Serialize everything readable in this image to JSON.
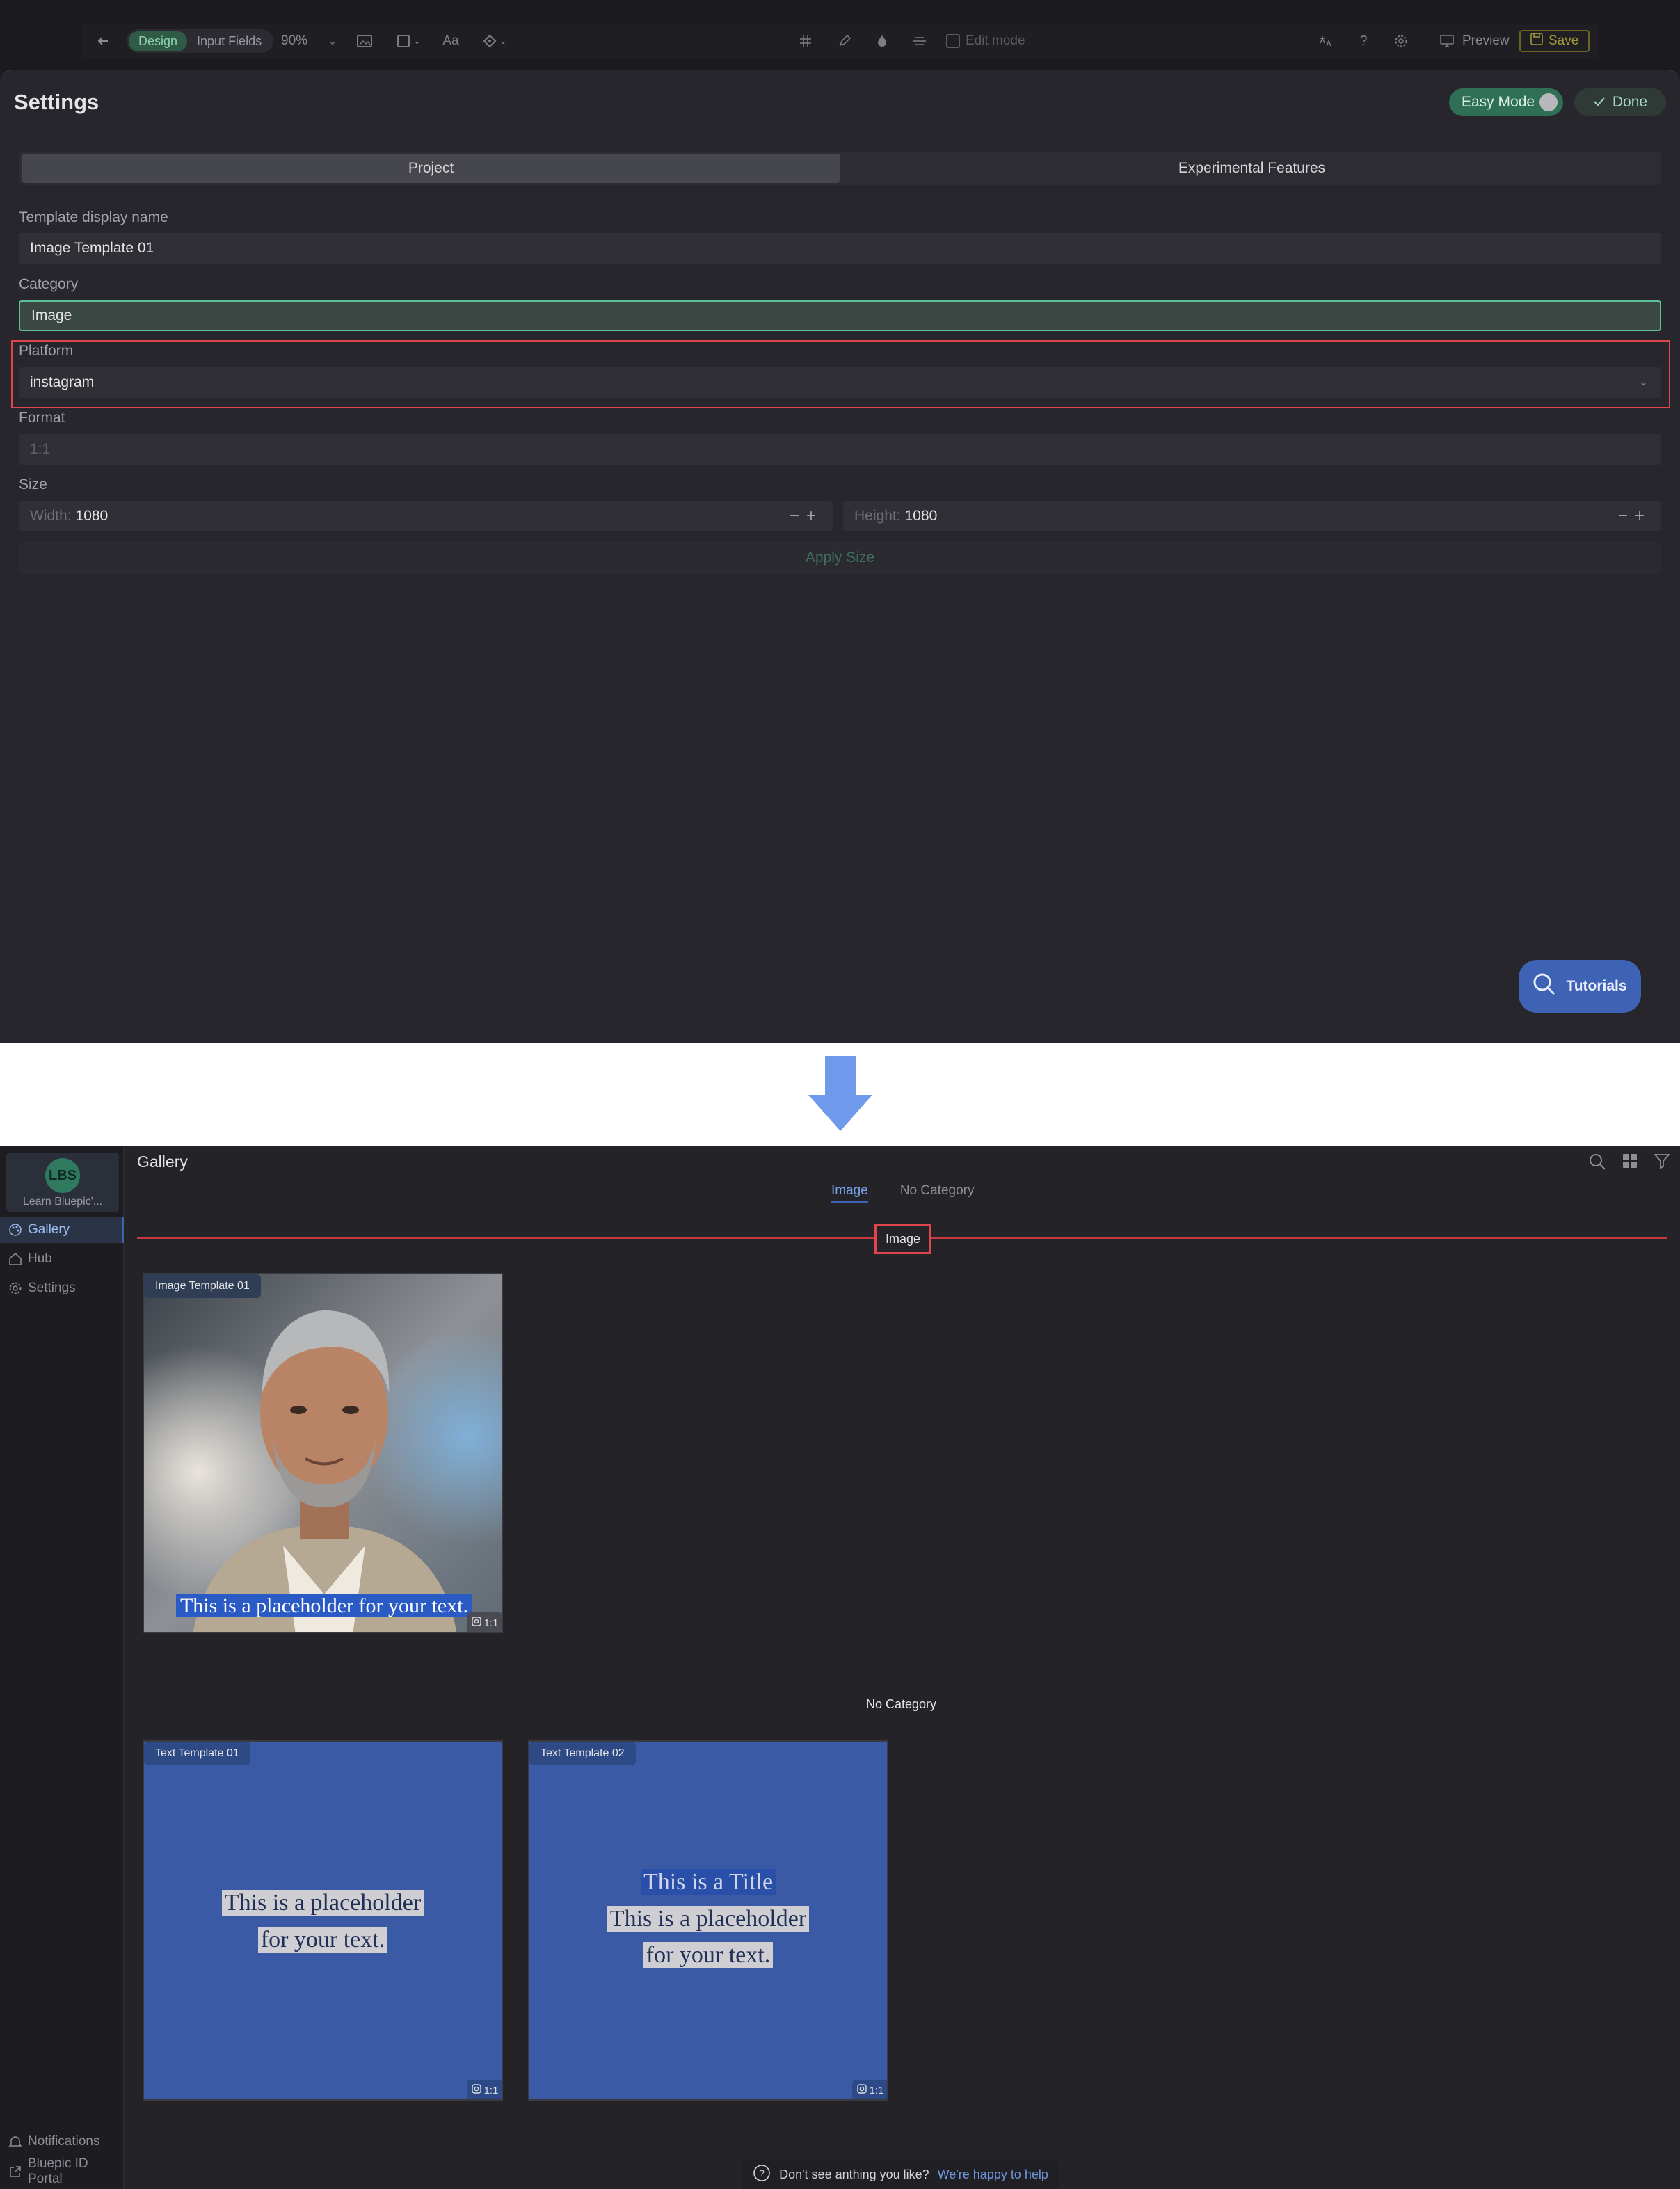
{
  "toolbar": {
    "mode_design": "Design",
    "mode_inputs": "Input Fields",
    "zoom": "90%",
    "edit_mode": "Edit mode",
    "preview": "Preview",
    "save": "Save"
  },
  "settings": {
    "title": "Settings",
    "easy_mode": "Easy Mode",
    "done": "Done",
    "tabs": [
      "Project",
      "Experimental Features"
    ],
    "template_label": "Template display name",
    "template_value": "Image Template 01",
    "category_label": "Category",
    "category_value": "Image",
    "platform_label": "Platform",
    "platform_value": "instagram",
    "format_label": "Format",
    "format_value": "1:1",
    "size_label": "Size",
    "width_prefix": "Width:",
    "width_value": "1080",
    "height_prefix": "Height:",
    "height_value": "1080",
    "apply_size": "Apply Size",
    "tutorials": "Tutorials"
  },
  "gallery": {
    "account_initials": "LBS",
    "account_name": "Learn Bluepic'...",
    "nav": [
      "Gallery",
      "Hub",
      "Settings"
    ],
    "bottom_nav": [
      "Notifications",
      "Bluepic ID Portal"
    ],
    "title": "Gallery",
    "subtabs": [
      "Image",
      "No Category"
    ],
    "section_image": "Image",
    "section_nocat": "No Category",
    "cards": [
      {
        "tag": "Image Template 01",
        "text": "This is a placeholder for your text.",
        "ratio": "1:1"
      },
      {
        "tag": "Text Template 01",
        "line1": "This is a placeholder",
        "line2": "for your text.",
        "ratio": "1:1"
      },
      {
        "tag": "Text Template 02",
        "title": "This is a Title",
        "line1": "This is a placeholder",
        "line2": "for your text.",
        "ratio": "1:1"
      }
    ],
    "help_text": "Don't see anthing you like?",
    "help_link": "We're happy to help"
  },
  "colors": {
    "accent_blue": "#3e63b5",
    "accent_green": "#2f6f56",
    "highlight_red": "#e0454b"
  }
}
